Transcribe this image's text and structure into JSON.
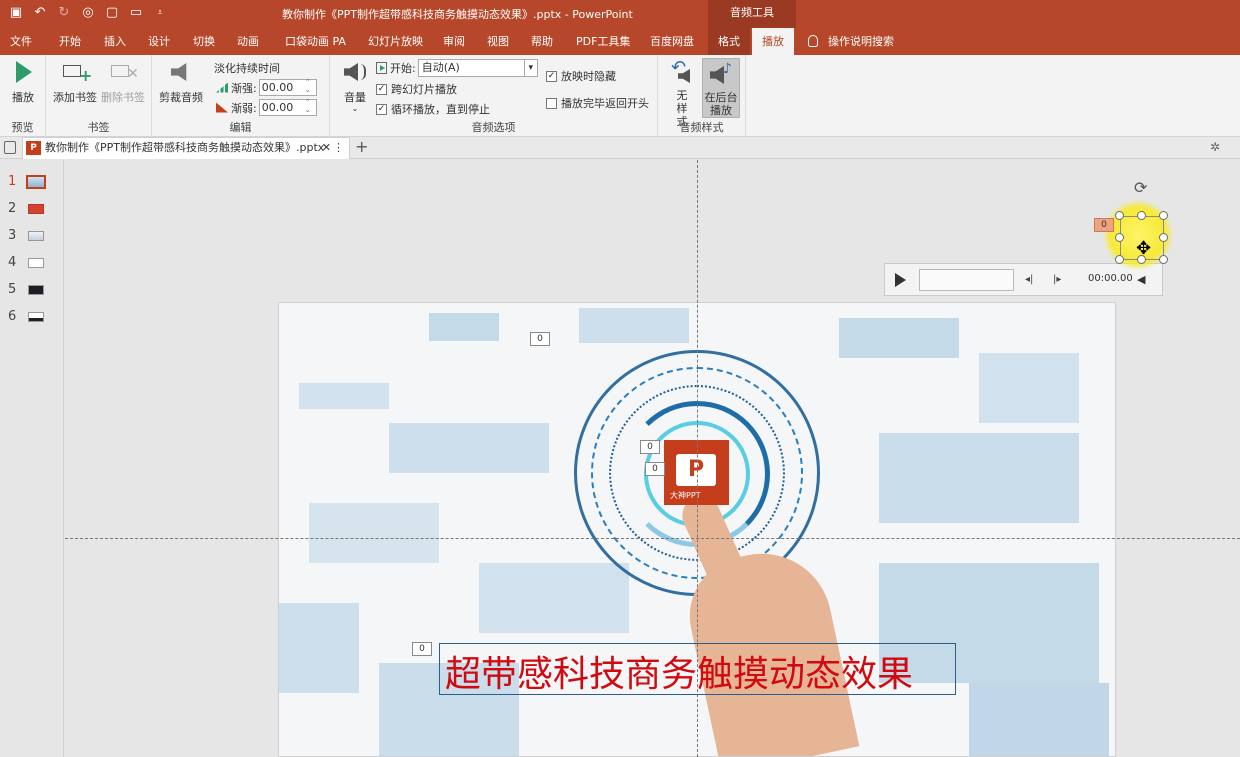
{
  "window": {
    "title": "教你制作《PPT制作超带感科技商务触摸动态效果》.pptx  -  PowerPoint",
    "context_group": "音频工具"
  },
  "tabs": [
    {
      "id": "file",
      "label": "文件"
    },
    {
      "id": "home",
      "label": "开始"
    },
    {
      "id": "insert",
      "label": "插入"
    },
    {
      "id": "design",
      "label": "设计"
    },
    {
      "id": "transitions",
      "label": "切换"
    },
    {
      "id": "animations",
      "label": "动画"
    },
    {
      "id": "pocket",
      "label": "口袋动画 PA"
    },
    {
      "id": "slideshow",
      "label": "幻灯片放映"
    },
    {
      "id": "review",
      "label": "审阅"
    },
    {
      "id": "view",
      "label": "视图"
    },
    {
      "id": "help",
      "label": "帮助"
    },
    {
      "id": "pdf",
      "label": "PDF工具集"
    },
    {
      "id": "baidu",
      "label": "百度网盘"
    },
    {
      "id": "format",
      "label": "格式"
    },
    {
      "id": "playback",
      "label": "播放"
    }
  ],
  "tell_me": "操作说明搜索",
  "ribbon": {
    "preview": {
      "play": "播放",
      "group": "预览"
    },
    "bookmarks": {
      "add": "添加书签",
      "remove": "删除书签",
      "group": "书签"
    },
    "editing": {
      "trim": "剪裁音频",
      "fade_title": "淡化持续时间",
      "fade_in_label": "渐强:",
      "fade_in_value": "00.00",
      "fade_out_label": "渐弱:",
      "fade_out_value": "00.00",
      "group": "编辑"
    },
    "audio_options": {
      "volume": "音量",
      "start_label": "开始:",
      "start_value": "自动(A)",
      "across_slides": "跨幻灯片播放",
      "loop": "循环播放，直到停止",
      "hide": "放映时隐藏",
      "rewind": "播放完毕返回开头",
      "group": "音频选项",
      "checked": {
        "across_slides": true,
        "loop": true,
        "hide": true,
        "rewind": false
      }
    },
    "audio_styles": {
      "no_style": "无样式",
      "background": "在后台播放",
      "group": "音频样式"
    }
  },
  "doc_tab": {
    "title": "教你制作《PPT制作超带感科技商务触摸动态效果》.pptx"
  },
  "slides": [
    {
      "num": "1",
      "active": true
    },
    {
      "num": "2",
      "active": false
    },
    {
      "num": "3",
      "active": false
    },
    {
      "num": "4",
      "active": false
    },
    {
      "num": "5",
      "active": false
    },
    {
      "num": "6",
      "active": false
    }
  ],
  "slide_content": {
    "title": "超带感科技商务触摸动态效果",
    "logo_text": "大神PPT",
    "anim_tags": [
      "0",
      "0",
      "0",
      "0"
    ],
    "audio_badge": "0"
  },
  "player": {
    "time": "00:00.00"
  },
  "colors": {
    "accent": "#b7472a",
    "title_red": "#d10a10",
    "context_tab": "#9a3a22"
  }
}
